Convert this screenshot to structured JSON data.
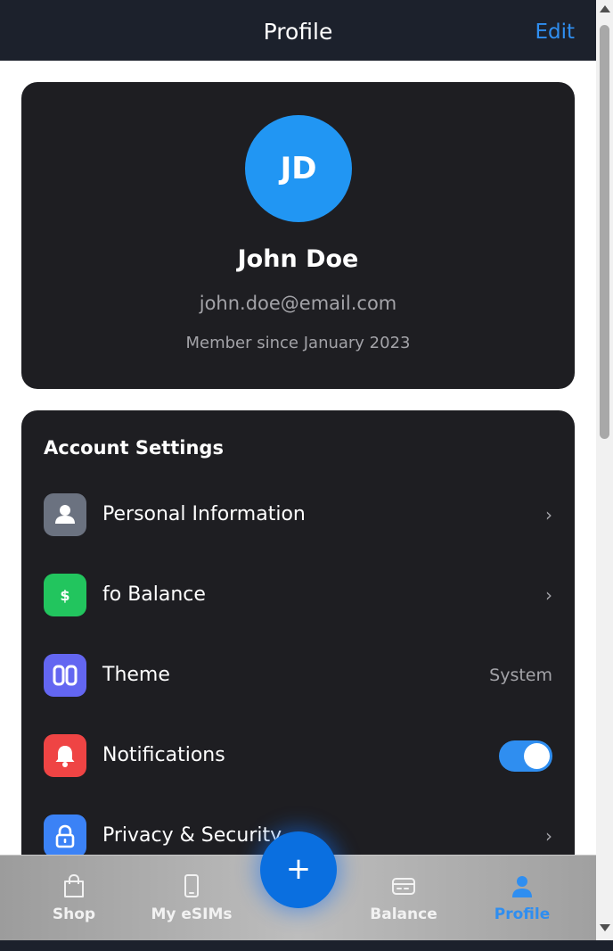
{
  "header": {
    "title": "Profile",
    "edit_label": "Edit"
  },
  "profile": {
    "initials": "JD",
    "name": "John Doe",
    "email": "john.doe@email.com",
    "member_since": "Member since January 2023"
  },
  "settings": {
    "section_title": "Account Settings",
    "items": [
      {
        "label": "Personal Information",
        "icon": "person-icon",
        "color": "#6b7280",
        "trailing": "›"
      },
      {
        "label": "fo Balance",
        "icon": "dollar-icon",
        "color": "#22c55e",
        "trailing": "›"
      },
      {
        "label": "Theme",
        "icon": "theme-icon",
        "color": "#6366f1",
        "value": "System"
      },
      {
        "label": "Notifications",
        "icon": "bell-icon",
        "color": "#ef4444",
        "toggle_on": true
      },
      {
        "label": "Privacy & Security",
        "icon": "lock-icon",
        "color": "#3b82f6",
        "trailing": "›"
      }
    ]
  },
  "tabbar": {
    "tabs": [
      {
        "label": "Shop",
        "icon": "bag-icon",
        "active": false
      },
      {
        "label": "My eSIMs",
        "icon": "phone-icon",
        "active": false
      },
      {
        "label": "Balance",
        "icon": "card-icon",
        "active": false
      },
      {
        "label": "Profile",
        "icon": "person-icon",
        "active": true
      }
    ],
    "fab_label": "+"
  },
  "colors": {
    "accent": "#2f8ef0",
    "header_bg": "#1c212c",
    "card_bg": "#1e1e22"
  }
}
